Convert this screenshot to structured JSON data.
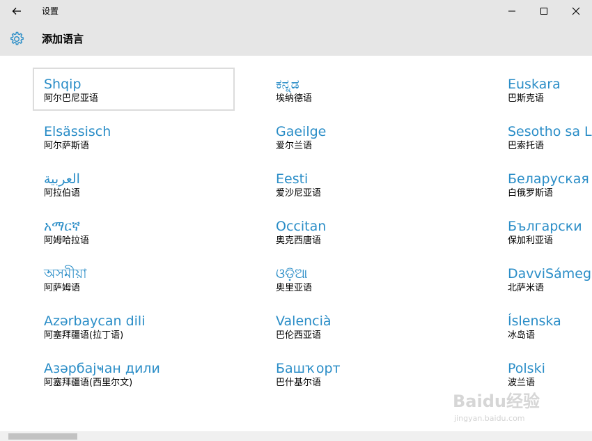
{
  "window": {
    "title": "设置",
    "back_icon": "arrow-left-icon",
    "minimize_icon": "minimize-icon",
    "maximize_icon": "maximize-icon",
    "close_icon": "close-icon"
  },
  "header": {
    "icon": "gear-icon",
    "title": "添加语言"
  },
  "languages": [
    [
      {
        "native": "Shqip",
        "zh": "阿尔巴尼亚语"
      },
      {
        "native": "Elsässisch",
        "zh": "阿尔萨斯语"
      },
      {
        "native": "العربية",
        "zh": "阿拉伯语"
      },
      {
        "native": "አማርኛ",
        "zh": "阿姆哈拉语"
      },
      {
        "native": "অসমীয়া",
        "zh": "阿萨姆语"
      },
      {
        "native": "Azərbaycan dili",
        "zh": "阿塞拜疆语(拉丁语)"
      },
      {
        "native": "Азәрбајҹан дили",
        "zh": "阿塞拜疆语(西里尔文)"
      }
    ],
    [
      {
        "native": "ಕನ್ನಡ",
        "zh": "埃纳德语"
      },
      {
        "native": "Gaeilge",
        "zh": "爱尔兰语"
      },
      {
        "native": "Eesti",
        "zh": "爱沙尼亚语"
      },
      {
        "native": "Occitan",
        "zh": "奥克西唐语"
      },
      {
        "native": "ଓଡ଼ିଆ",
        "zh": "奥里亚语"
      },
      {
        "native": "Valencià",
        "zh": "巴伦西亚语"
      },
      {
        "native": "Башҡорт",
        "zh": "巴什基尔语"
      }
    ],
    [
      {
        "native": "Euskara",
        "zh": "巴斯克语"
      },
      {
        "native": "Sesotho sa Leboa",
        "zh": "巴索托语"
      },
      {
        "native": "Беларуская",
        "zh": "白俄罗斯语"
      },
      {
        "native": "Български",
        "zh": "保加利亚语"
      },
      {
        "native": "DavviSámegiella",
        "zh": "北萨米语"
      },
      {
        "native": "Íslenska",
        "zh": "冰岛语"
      },
      {
        "native": "Polski",
        "zh": "波兰语"
      }
    ]
  ],
  "selected": {
    "col": 0,
    "row": 0
  },
  "colors": {
    "accent": "#2a8dc7",
    "titlebar_bg": "#e6e6e6",
    "selected_border": "#dcdcdc"
  },
  "watermark": {
    "text": "Baidu经验",
    "sub": "jingyan.baidu.com"
  }
}
